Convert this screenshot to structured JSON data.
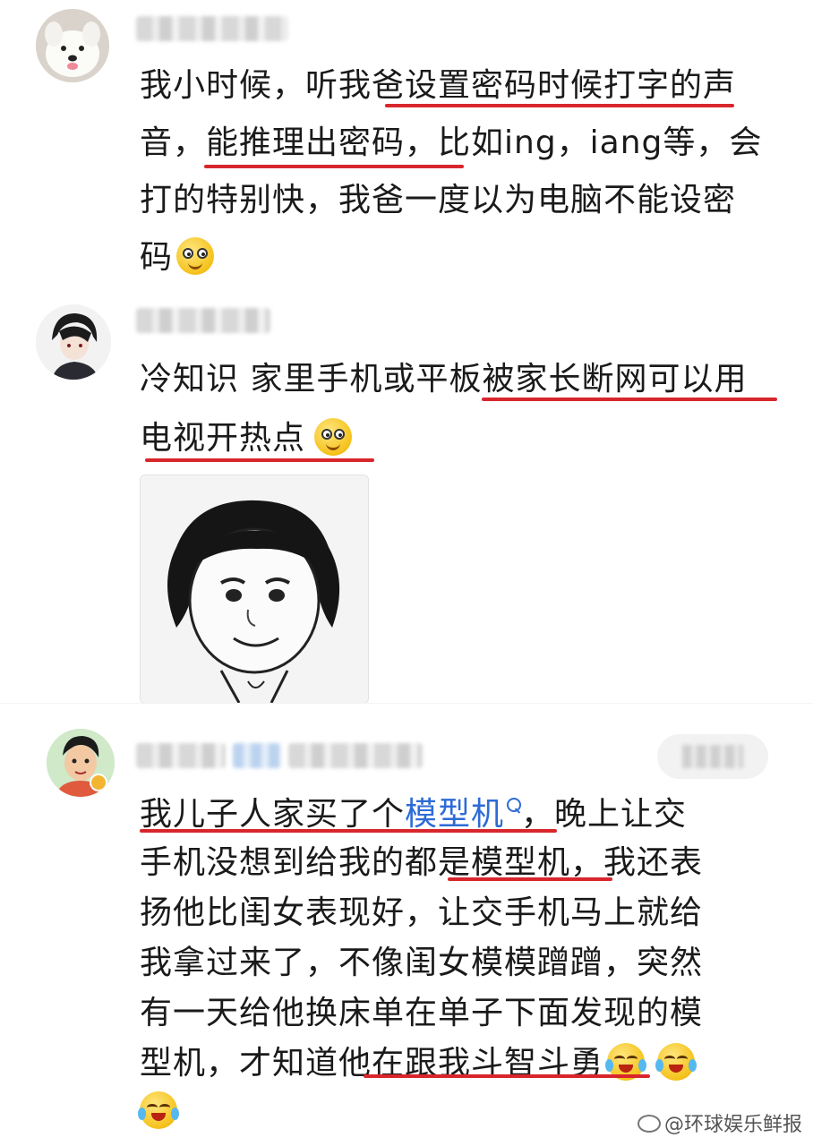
{
  "comments": [
    {
      "lines": [
        "我小时候，听我爸设置密码时候打字的声",
        "音，能推理出密码，比如ing，iang等，会",
        "打的特别快，我爸一度以为电脑不能设密",
        "码"
      ],
      "emoji": "dizzy-eyes-emoji"
    },
    {
      "lines": [
        "冷知识 家里手机或平板被家长断网可以用",
        "电视开热点"
      ],
      "emoji": "smile-emoji",
      "image": "meme-face-sticker"
    },
    {
      "line1_before_link": "我儿子人家买了个",
      "link_text": "模型机",
      "line1_after_link": "，晚上让交",
      "lines": [
        "手机没想到给我的都是模型机，我还表",
        "扬他比闺女表现好，让交手机马上就给",
        "我拿过来了，不像闺女模模蹭蹭，突然",
        "有一天给他换床单在单子下面发现的模",
        "型机，才知道他在跟我斗智斗勇"
      ],
      "emoji": "laughing-tears-emoji"
    }
  ],
  "watermark": "@环球娱乐鲜报",
  "colors": {
    "underline": "#d8262c",
    "link": "#2d6bd6"
  }
}
